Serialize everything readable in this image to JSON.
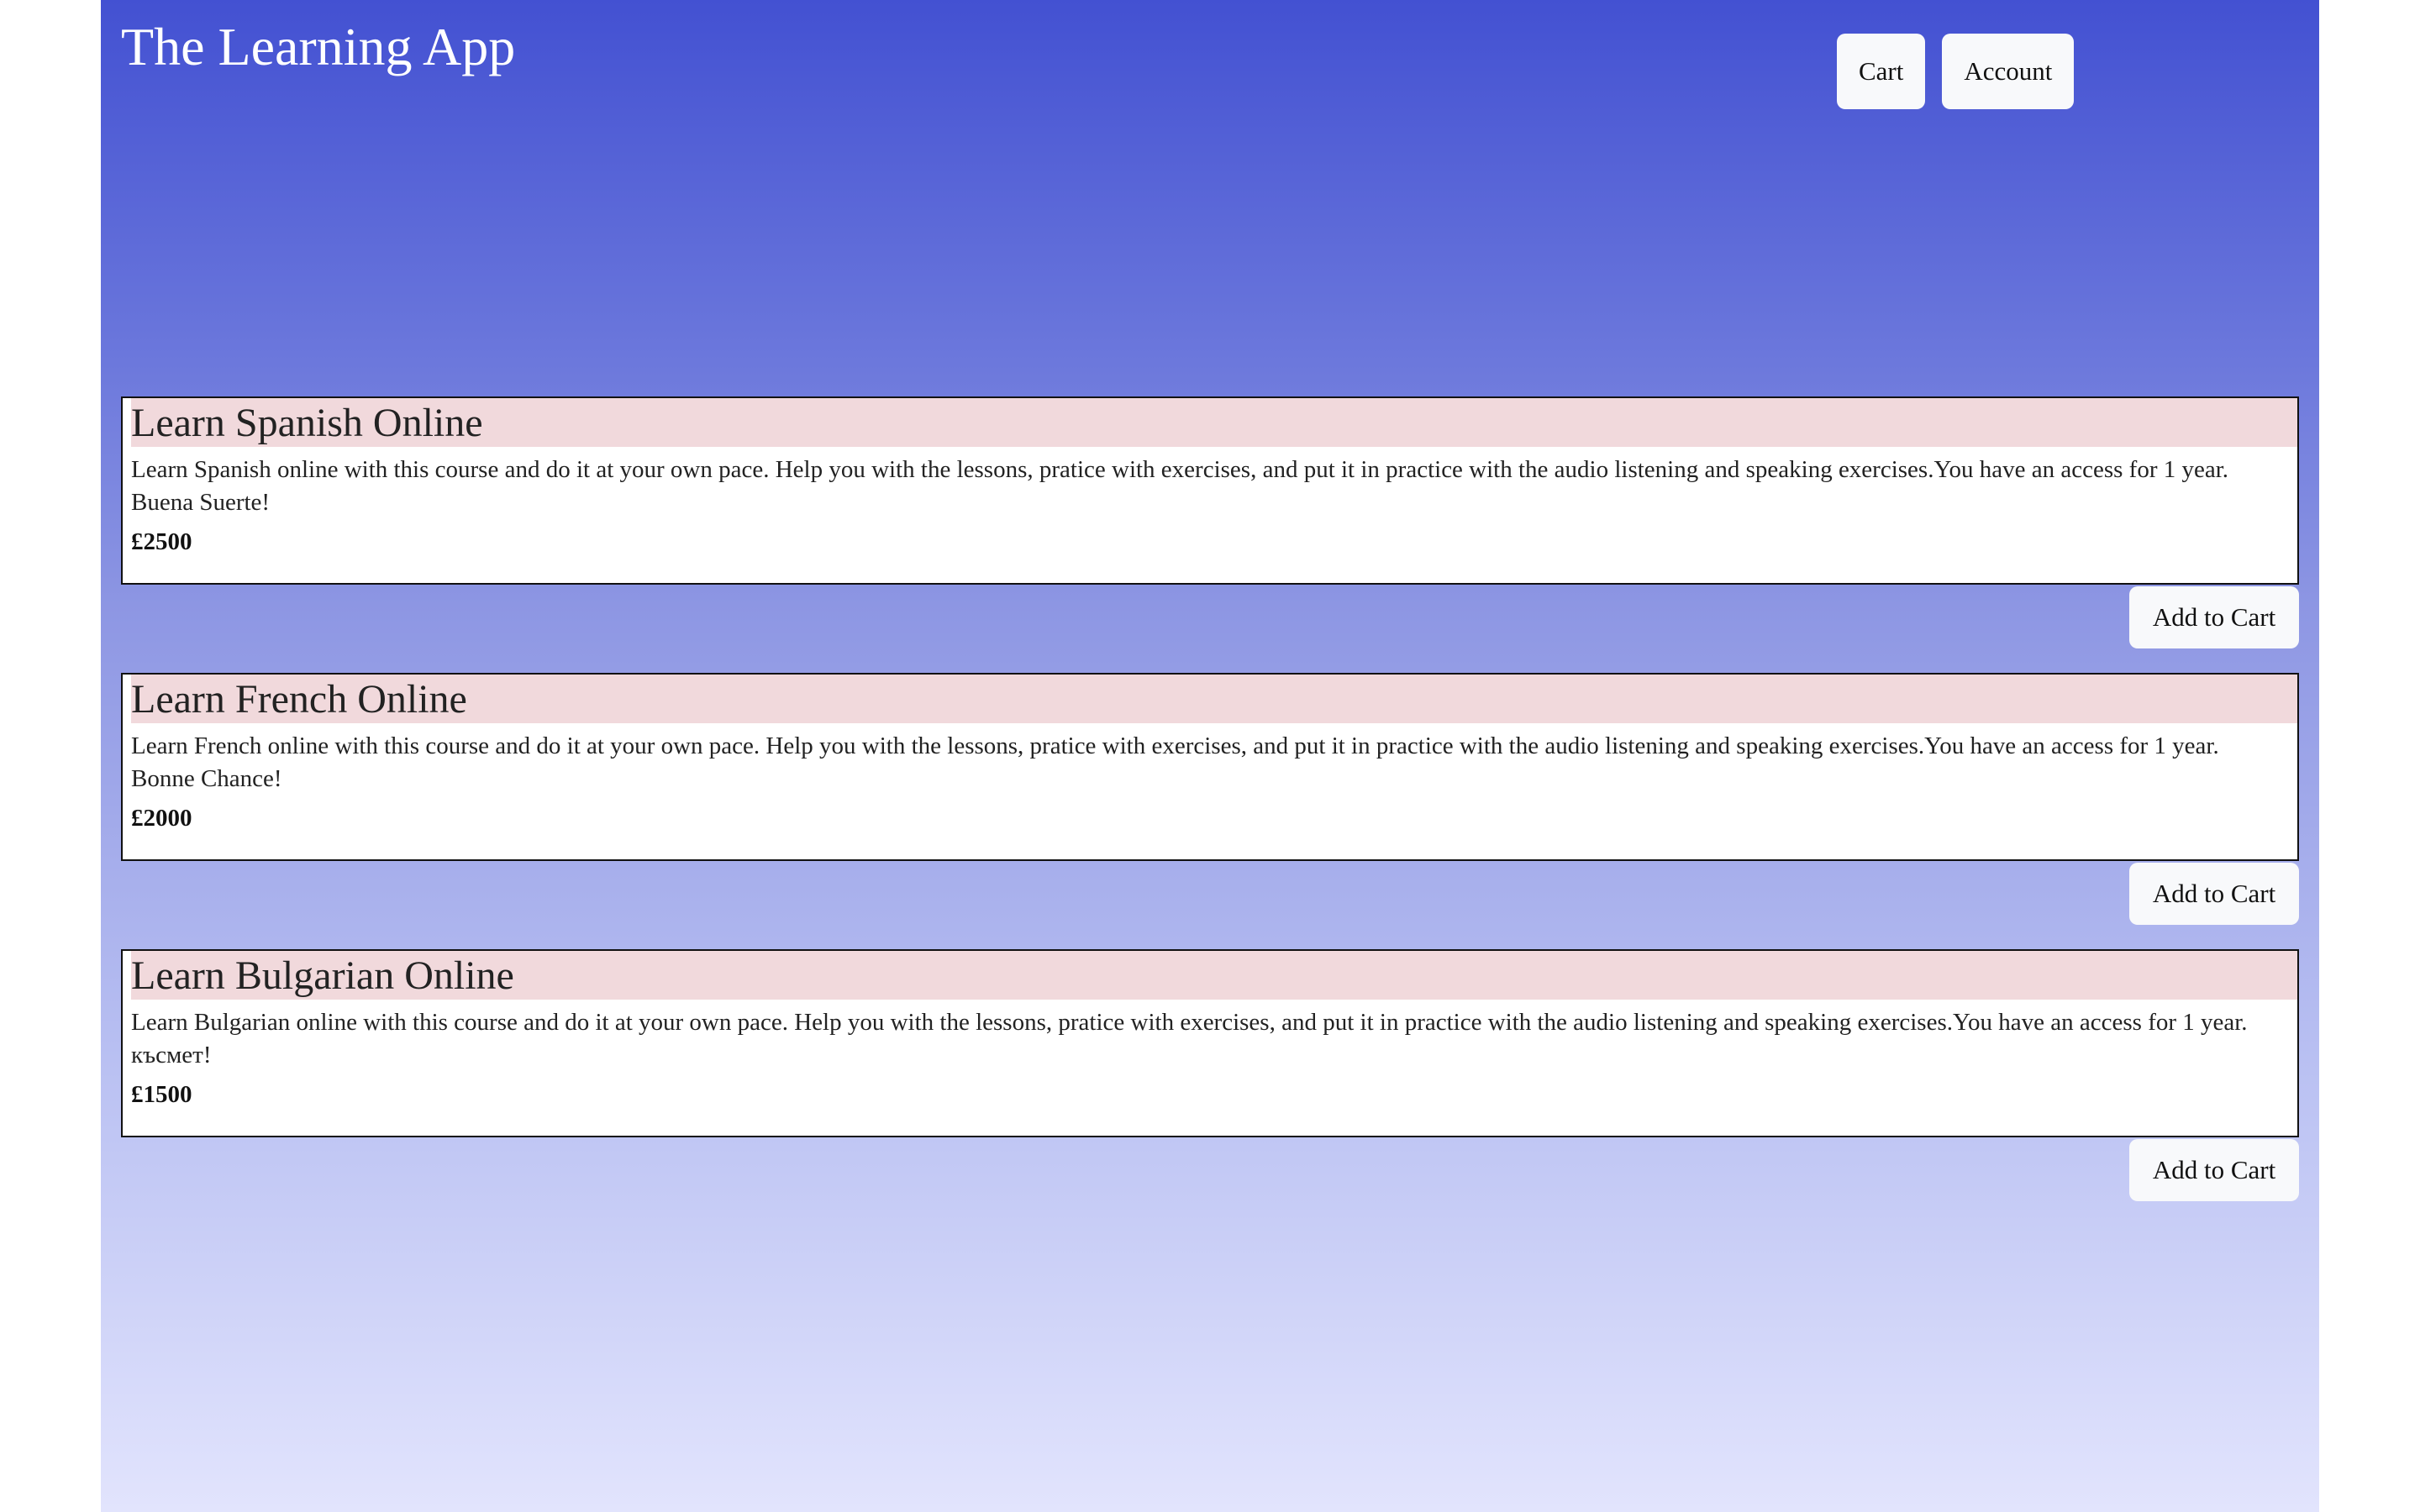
{
  "header": {
    "title": "The Learning App",
    "nav": {
      "cart_label": "Cart",
      "account_label": "Account"
    }
  },
  "courses": [
    {
      "title": "Learn Spanish Online",
      "description": "Learn Spanish online with this course and do it at your own pace. Help you with the lessons, pratice with exercises, and put it in practice with the audio listening and speaking exercises.You have an access for 1 year. Buena Suerte!",
      "price": "£2500",
      "button_label": "Add to Cart"
    },
    {
      "title": "Learn French Online",
      "description": "Learn French online with this course and do it at your own pace. Help you with the lessons, pratice with exercises, and put it in practice with the audio listening and speaking exercises.You have an access for 1 year. Bonne Chance!",
      "price": "£2000",
      "button_label": "Add to Cart"
    },
    {
      "title": "Learn Bulgarian Online",
      "description": "Learn Bulgarian online with this course and do it at your own pace. Help you with the lessons, pratice with exercises, and put it in practice with the audio listening and speaking exercises.You have an access for 1 year. късмет!",
      "price": "£1500",
      "button_label": "Add to Cart"
    }
  ]
}
